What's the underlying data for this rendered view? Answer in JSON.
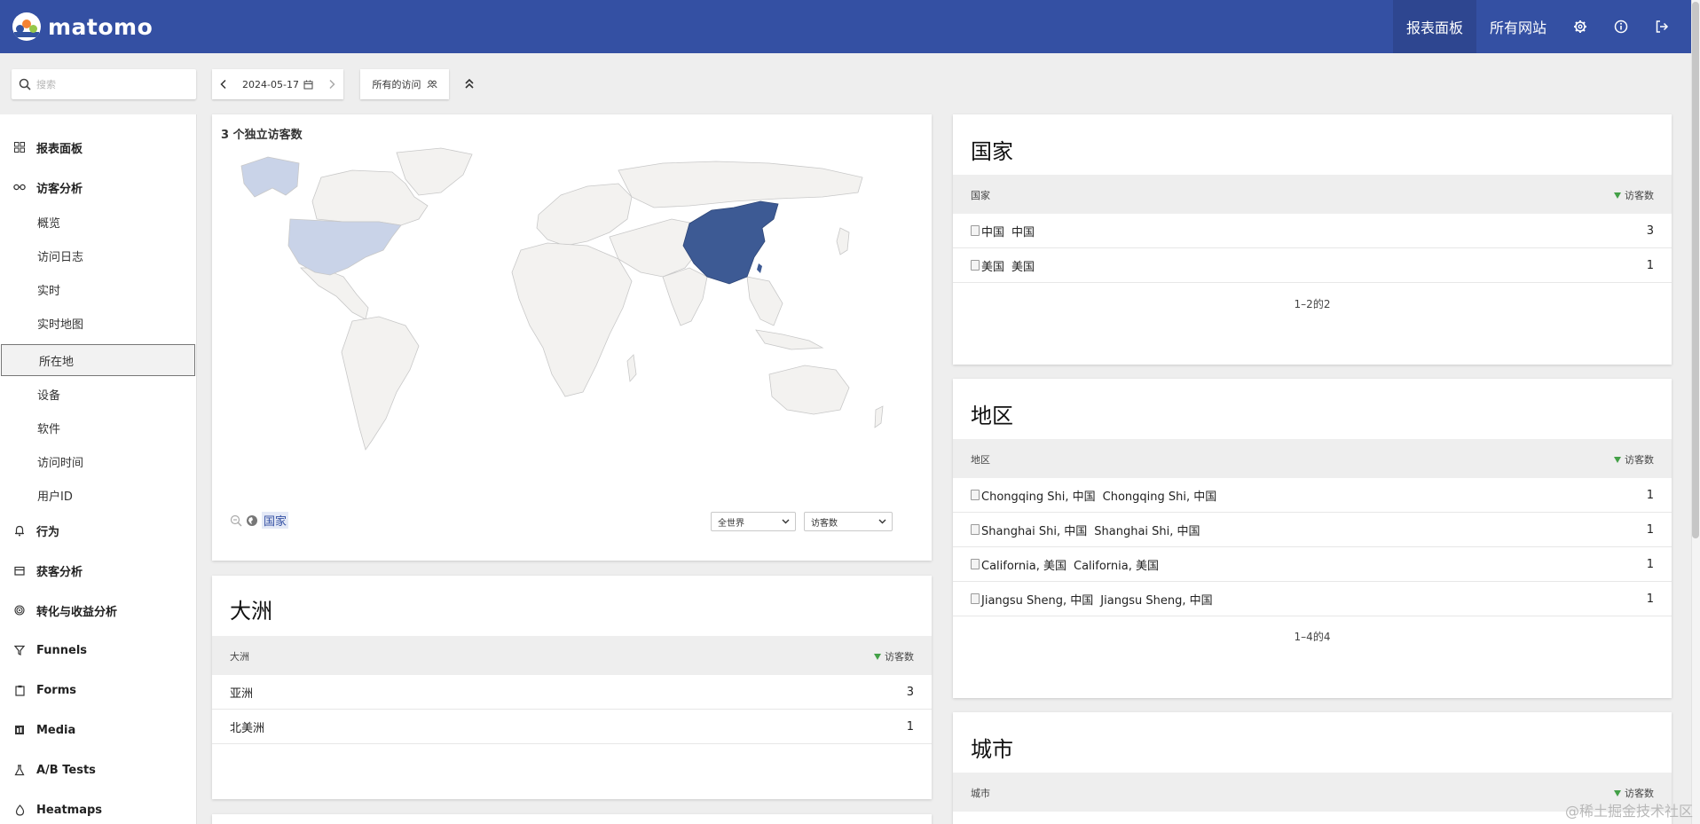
{
  "app": {
    "logo_text": "matomo"
  },
  "topnav": {
    "dashboard": "报表面板",
    "all_websites": "所有网站"
  },
  "search": {
    "placeholder": "搜索"
  },
  "period": {
    "date": "2024-05-17"
  },
  "segment": {
    "label": "所有的访问"
  },
  "sidebar": {
    "dashboard": "报表面板",
    "visitors": "访客分析",
    "visitor_items": [
      "概览",
      "访问日志",
      "实时",
      "实时地图",
      "所在地",
      "设备",
      "软件",
      "访问时间",
      "用户ID"
    ],
    "behaviour": "行为",
    "acquisition": "获客分析",
    "goals": "转化与收益分析",
    "funnels": "Funnels",
    "forms": "Forms",
    "media": "Media",
    "ab_tests": "A/B Tests",
    "heatmaps": "Heatmaps"
  },
  "map": {
    "title": "3 个独立访客数",
    "breadcrumb": "国家",
    "region_select": "全世界",
    "metric_select": "访客数",
    "colors": {
      "high": "#3d5a94",
      "low": "#c9d3e8",
      "empty": "#f3f2f0",
      "border": "#c8c8c8"
    }
  },
  "continent": {
    "title": "大洲",
    "col_label": "大洲",
    "col_metric": "访客数",
    "rows": [
      {
        "name": "亚洲",
        "value": "3"
      },
      {
        "name": "北美洲",
        "value": "1"
      }
    ]
  },
  "country": {
    "title": "国家",
    "col_label": "国家",
    "col_metric": "访客数",
    "rows": [
      {
        "alt": "中国",
        "name": "中国",
        "value": "3"
      },
      {
        "alt": "美国",
        "name": "美国",
        "value": "1"
      }
    ],
    "pager": "1–2的2"
  },
  "region": {
    "title": "地区",
    "col_label": "地区",
    "col_metric": "访客数",
    "rows": [
      {
        "alt": "Chongqing Shi, 中国",
        "name": "Chongqing Shi, 中国",
        "value": "1"
      },
      {
        "alt": "Shanghai Shi, 中国",
        "name": "Shanghai Shi, 中国",
        "value": "1"
      },
      {
        "alt": "California, 美国",
        "name": "California, 美国",
        "value": "1"
      },
      {
        "alt": "Jiangsu Sheng, 中国",
        "name": "Jiangsu Sheng, 中国",
        "value": "1"
      }
    ],
    "pager": "1–4的4"
  },
  "city": {
    "title": "城市",
    "col_label": "城市",
    "col_metric": "访客数"
  },
  "watermark": "@稀土掘金技术社区"
}
